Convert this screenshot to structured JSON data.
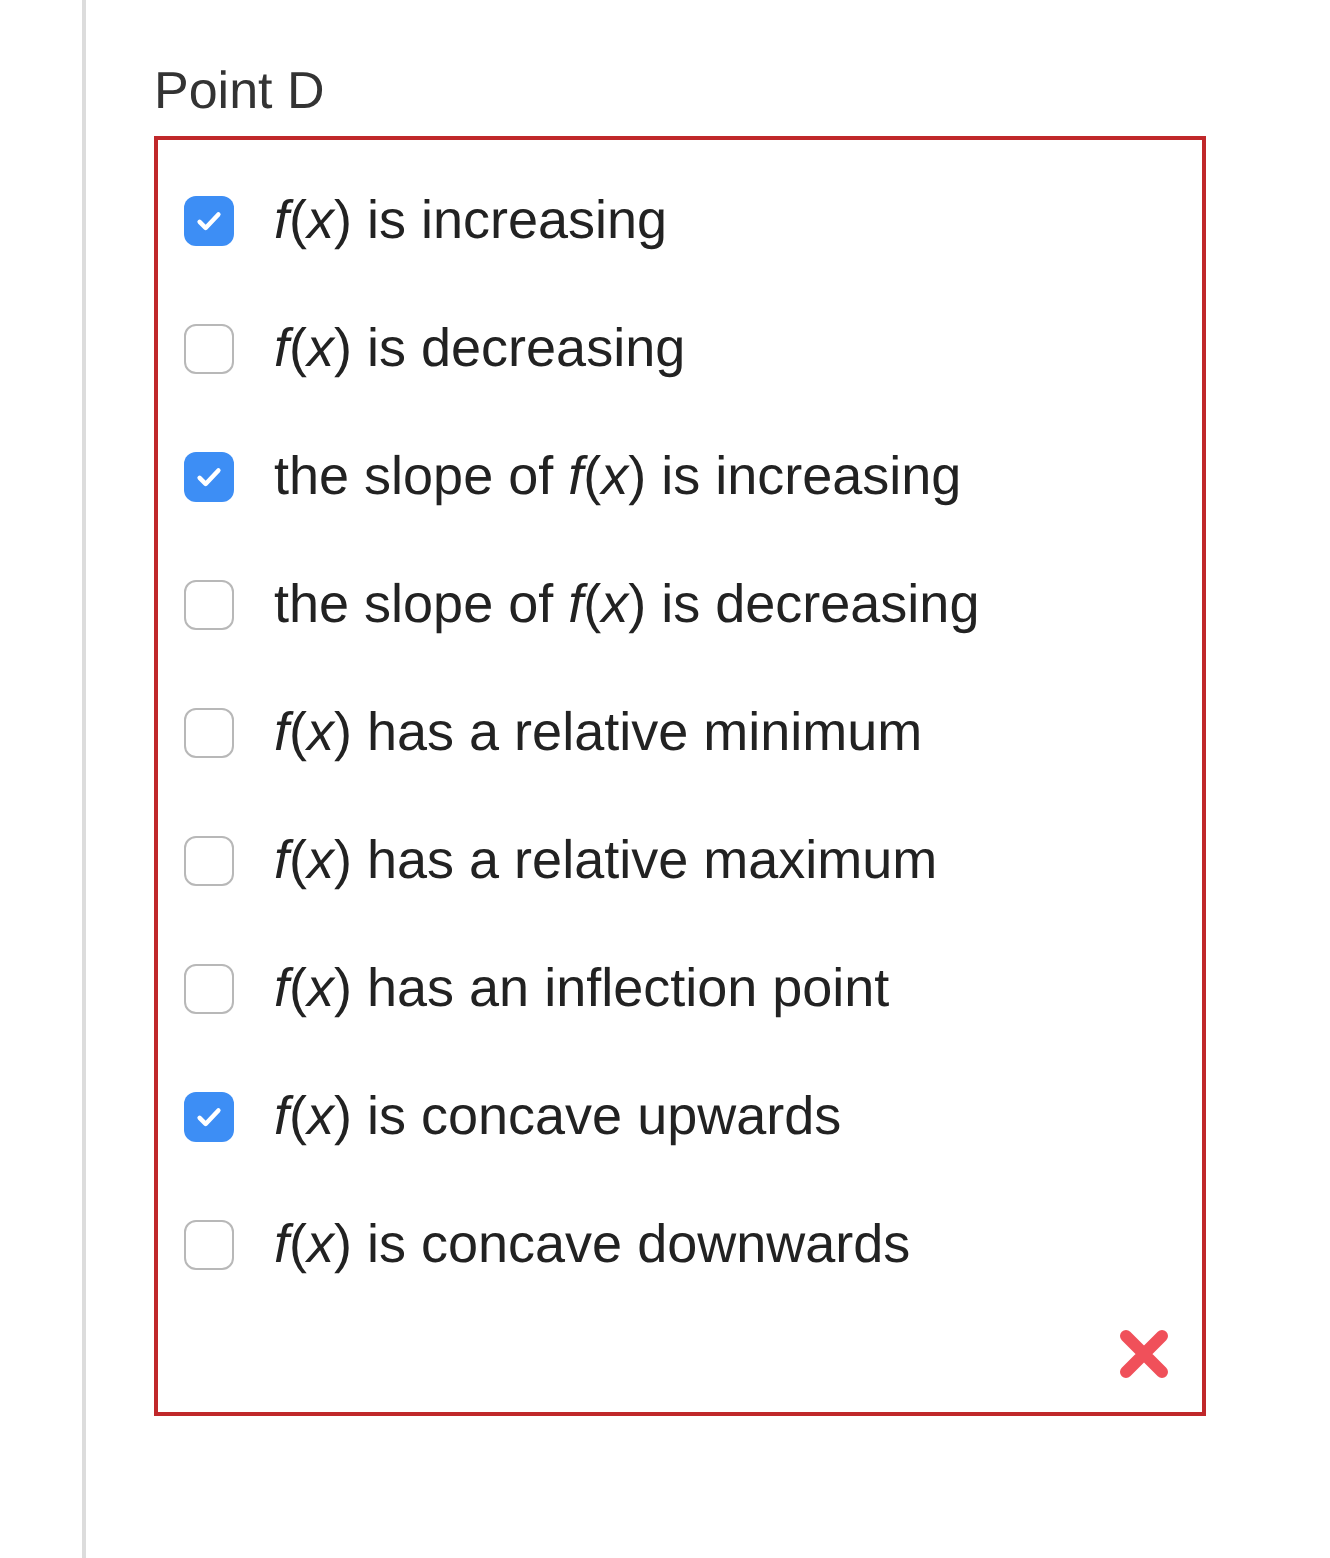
{
  "question": {
    "label": "Point D",
    "incorrect": true,
    "options": [
      {
        "text": "*f*(*x*) is increasing",
        "checked": true
      },
      {
        "text": "*f*(*x*) is decreasing",
        "checked": false
      },
      {
        "text": "the slope of *f*(*x*) is increasing",
        "checked": true
      },
      {
        "text": "the slope of *f*(*x*) is decreasing",
        "checked": false
      },
      {
        "text": "*f*(*x*) has a relative minimum",
        "checked": false
      },
      {
        "text": "*f*(*x*) has a relative maximum",
        "checked": false
      },
      {
        "text": "*f*(*x*) has an inflection point",
        "checked": false
      },
      {
        "text": "*f*(*x*) is concave upwards",
        "checked": true
      },
      {
        "text": "*f*(*x*) is concave downwards",
        "checked": false
      }
    ]
  }
}
